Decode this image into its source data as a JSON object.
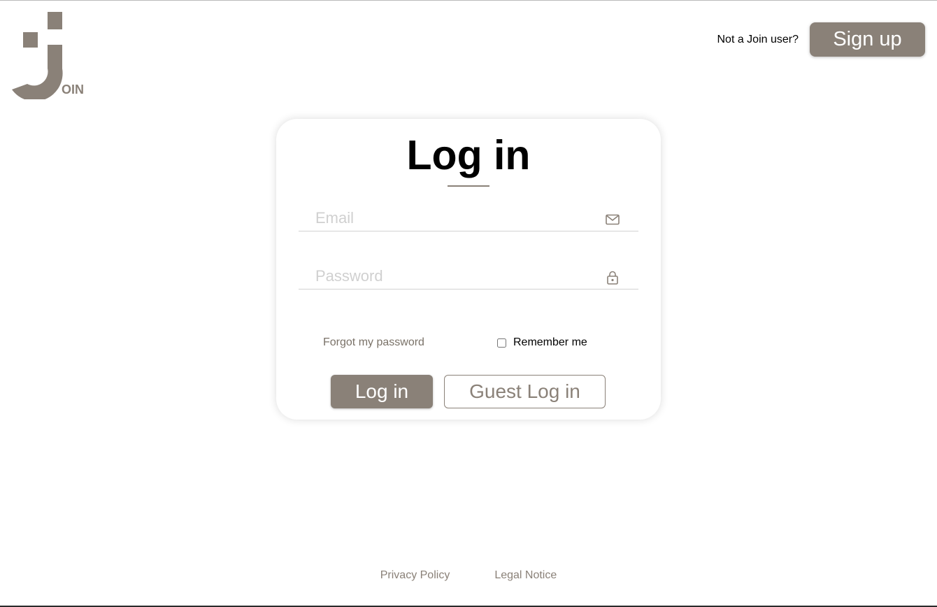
{
  "brand": {
    "logo_text": "OIN",
    "color": "#8a8178"
  },
  "header": {
    "note": "Not a Join user?",
    "signup_label": "Sign up"
  },
  "login_card": {
    "title": "Log in",
    "email": {
      "placeholder": "Email",
      "value": "",
      "icon": "mail-icon"
    },
    "password": {
      "placeholder": "Password",
      "value": "",
      "icon": "lock-icon"
    },
    "forgot_label": "Forgot my password",
    "remember_label": "Remember me",
    "remember_checked": false,
    "login_label": "Log in",
    "guest_login_label": "Guest Log in"
  },
  "footer": {
    "privacy_label": "Privacy Policy",
    "legal_label": "Legal Notice"
  }
}
